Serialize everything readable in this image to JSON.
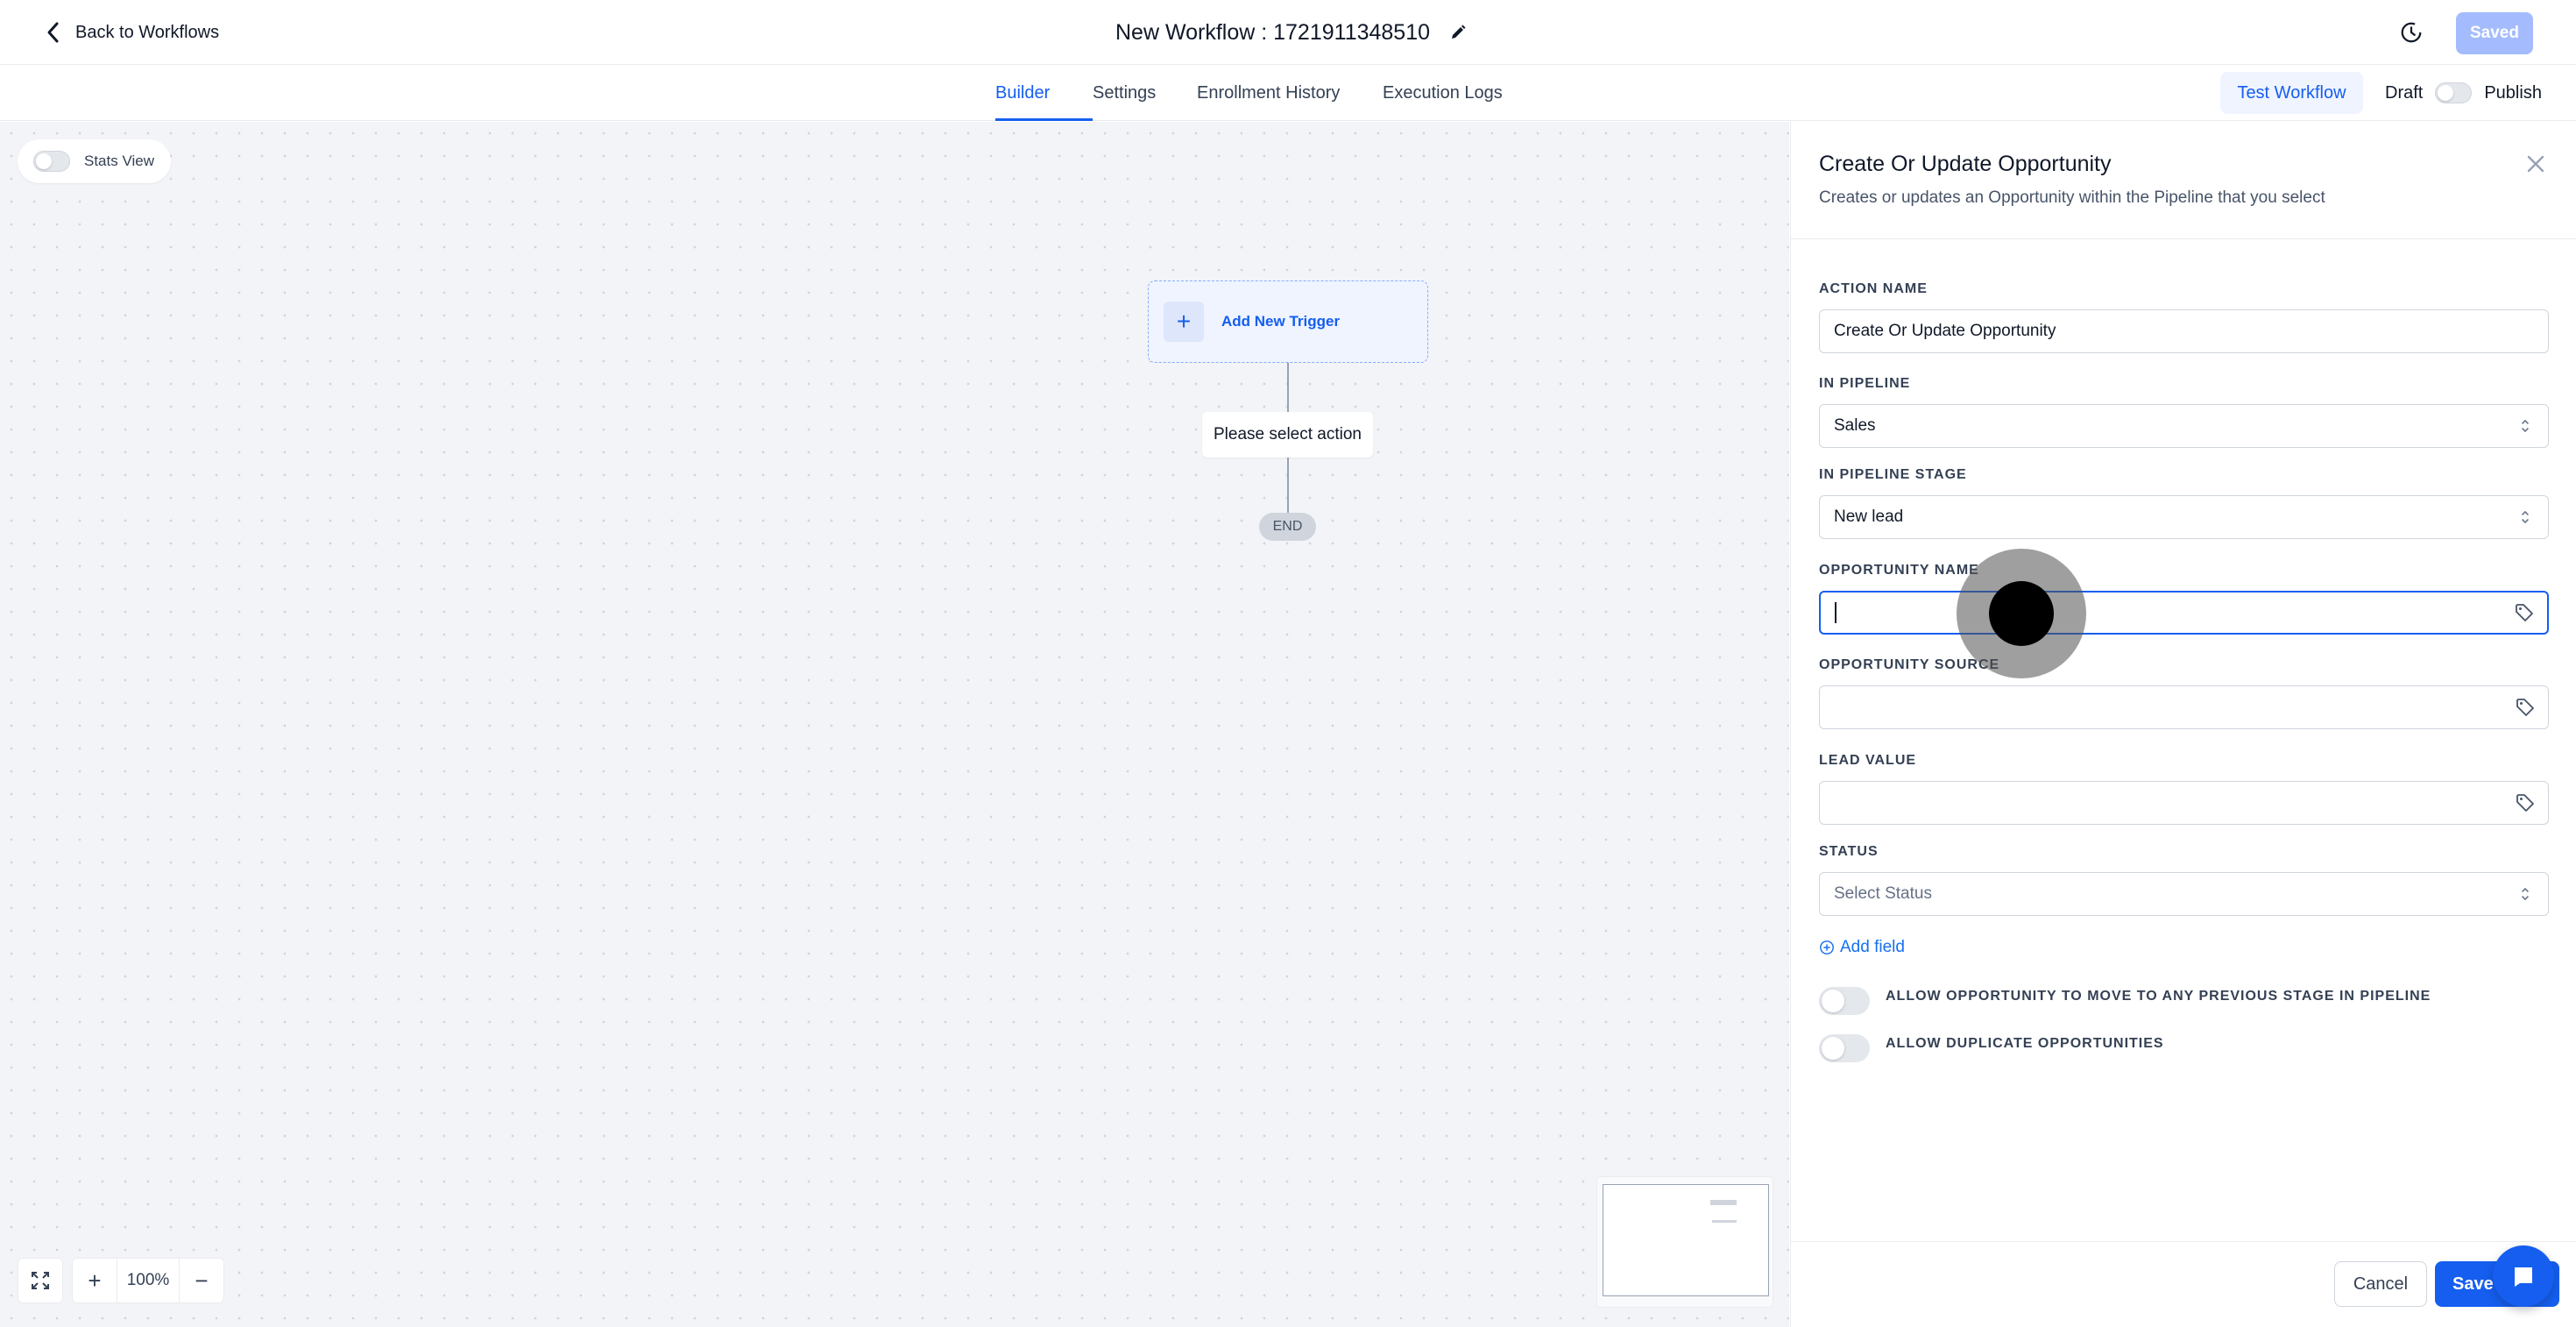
{
  "header": {
    "back_label": "Back to Workflows",
    "workflow_title": "New Workflow : 1721911348510",
    "saved_label": "Saved"
  },
  "tabs": [
    {
      "label": "Builder",
      "active": true
    },
    {
      "label": "Settings",
      "active": false
    },
    {
      "label": "Enrollment History",
      "active": false
    },
    {
      "label": "Execution Logs",
      "active": false
    }
  ],
  "toolbar": {
    "test_label": "Test Workflow",
    "draft_label": "Draft",
    "publish_label": "Publish"
  },
  "canvas": {
    "stats_label": "Stats View",
    "trigger_label": "Add New Trigger",
    "action_label": "Please select action",
    "end_label": "END",
    "zoom_level": "100%"
  },
  "panel": {
    "title": "Create Or Update Opportunity",
    "subtitle": "Creates or updates an Opportunity within the Pipeline that you select",
    "fields": {
      "action_name_label": "ACTION NAME",
      "action_name_value": "Create Or Update Opportunity",
      "pipeline_label": "IN PIPELINE",
      "pipeline_value": "Sales",
      "stage_label": "IN PIPELINE STAGE",
      "stage_value": "New lead",
      "opp_name_label": "OPPORTUNITY NAME",
      "opp_name_value": "",
      "opp_source_label": "OPPORTUNITY SOURCE",
      "opp_source_value": "",
      "lead_value_label": "LEAD VALUE",
      "lead_value_value": "",
      "status_label": "STATUS",
      "status_placeholder": "Select Status"
    },
    "add_field_label": "Add field",
    "toggles": [
      {
        "label": "ALLOW OPPORTUNITY TO MOVE TO ANY PREVIOUS STAGE IN PIPELINE",
        "on": false
      },
      {
        "label": "ALLOW DUPLICATE OPPORTUNITIES",
        "on": false
      }
    ],
    "cancel_label": "Cancel",
    "save_label": "Save Action"
  },
  "colors": {
    "accent": "#155eef",
    "saved_disabled": "#a4bcfd",
    "canvas_bg": "#f2f4f7"
  }
}
